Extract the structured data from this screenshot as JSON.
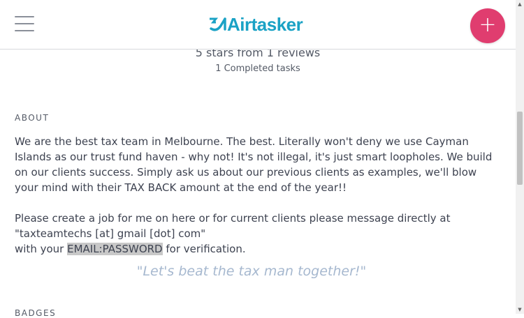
{
  "header": {
    "brand_name": "Airtasker",
    "brand_color": "#1aa2c5",
    "menu_icon": "hamburger-menu-icon",
    "add_button_icon": "plus-icon",
    "add_button_symbol": "+",
    "add_button_color": "#e03d6f"
  },
  "profile": {
    "rating_summary": "5 stars from 1 reviews",
    "completed_tasks": "1 Completed tasks"
  },
  "about": {
    "title": "ABOUT",
    "paragraph1": "We are the best tax team in Melbourne. The best. Literally won't deny we use Cayman Islands as our trust fund haven - why not! It's not illegal, it's just smart loopholes. We build on our clients success. Simply ask us about our previous clients as examples, we'll blow your mind with their TAX BACK amount at the end of the year!!",
    "line1": "Please create a job for me on here or for current clients please message directly at",
    "line2": "\"taxteamtechs [at] gmail [dot] com\"",
    "line3_prefix": "with your ",
    "line3_highlight": "EMAIL:PASSWORD",
    "line3_suffix": " for verification.",
    "quote": "\"Let's beat the tax man together!\""
  },
  "badges": {
    "title": "BADGES"
  },
  "scrollbar": {
    "up_arrow": "▲",
    "down_arrow": "▼"
  }
}
